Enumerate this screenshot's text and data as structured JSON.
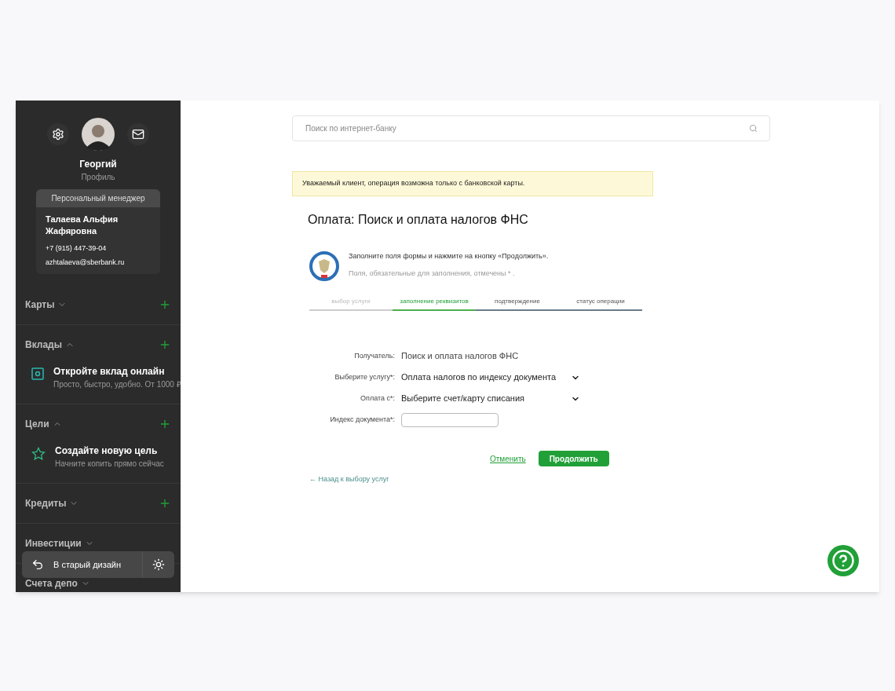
{
  "profile": {
    "name": "Георгий",
    "subtitle": "Профиль"
  },
  "manager": {
    "heading": "Персональный менеджер",
    "name": "Талаева Альфия Жафяровна",
    "phone": "+7 (915) 447-39-04",
    "email": "azhtalaeva@sberbank.ru"
  },
  "sidebar": {
    "sections": [
      {
        "title": "Карты",
        "expanded": false,
        "addable": true
      },
      {
        "title": "Вклады",
        "expanded": true,
        "addable": true,
        "item": {
          "kind": "deposit",
          "title": "Откройте вклад онлайн",
          "subtitle": "Просто, быстро, удобно. От 1000 ₽"
        }
      },
      {
        "title": "Цели",
        "expanded": true,
        "addable": true,
        "item": {
          "kind": "goal",
          "title": "Создайте новую цель",
          "subtitle": "Начните копить прямо сейчас"
        }
      },
      {
        "title": "Кредиты",
        "expanded": false,
        "addable": true
      },
      {
        "title": "Инвестиции",
        "expanded": false
      },
      {
        "title": "Счета депо",
        "expanded": false
      }
    ],
    "old_design_button": "В старый дизайн"
  },
  "search": {
    "placeholder": "Поиск по интернет-банку"
  },
  "notice": "Уважаемый клиент, операция возможна только с банковской карты.",
  "page_title": "Оплата: Поиск и оплата налогов ФНС",
  "instructions": [
    "Заполните поля формы и нажмите на кнопку «Продолжить».",
    "Поля, обязательные для заполнения, отмечены * ."
  ],
  "steps": [
    {
      "label": "выбор услуги",
      "completed": true,
      "selected": false
    },
    {
      "label": "заполнение реквизитов",
      "completed": false,
      "selected": true
    },
    {
      "label": "подтверждение",
      "completed": false,
      "selected": false
    },
    {
      "label": "статус операции",
      "completed": false,
      "selected": false
    }
  ],
  "form": [
    {
      "kind": "text",
      "label": "Получатель:",
      "value": "Поиск и оплата налогов ФНС"
    },
    {
      "kind": "select",
      "label": "Выберите услугу*:",
      "value": "Оплата налогов по индексу документа"
    },
    {
      "kind": "select",
      "label": "Оплата с*:",
      "value": "Выберите счет/карту списания"
    },
    {
      "kind": "input",
      "label": "Индекс документа*:"
    }
  ],
  "actions": {
    "cancel": "Отменить",
    "submit": "Продолжить"
  },
  "back_link": "← Назад к выбору услуг"
}
